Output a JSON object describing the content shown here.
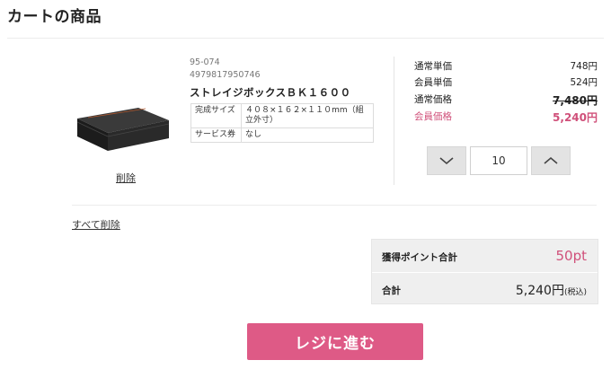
{
  "page": {
    "title": "カートの商品"
  },
  "item": {
    "code": "95-074",
    "jan": "4979817950746",
    "name": "ストレイジボックスＢＫ１６００",
    "specs": [
      {
        "label": "完成サイズ",
        "value": "４０８×１６２×１１０mm（組立外寸）"
      },
      {
        "label": "サービス券",
        "value": "なし"
      }
    ],
    "delete_label": "削除",
    "prices": [
      {
        "label": "通常単価",
        "value": "748円"
      },
      {
        "label": "会員単価",
        "value": "524円"
      },
      {
        "label": "通常価格",
        "value": "7,480円"
      },
      {
        "label": "会員価格",
        "value": "5,240円"
      }
    ],
    "quantity": "10",
    "icons": {
      "decrease": "chevron-down-icon",
      "increase": "chevron-up-icon"
    }
  },
  "delete_all_label": "すべて削除",
  "summary": {
    "points_label": "獲得ポイント合計",
    "points_value": "50pt",
    "total_label": "合計",
    "total_value": "5,240円",
    "tax_note": "(税込)"
  },
  "checkout_label": "レジに進む",
  "colors": {
    "accent": "#de5a86",
    "member_price": "#d0507a"
  }
}
